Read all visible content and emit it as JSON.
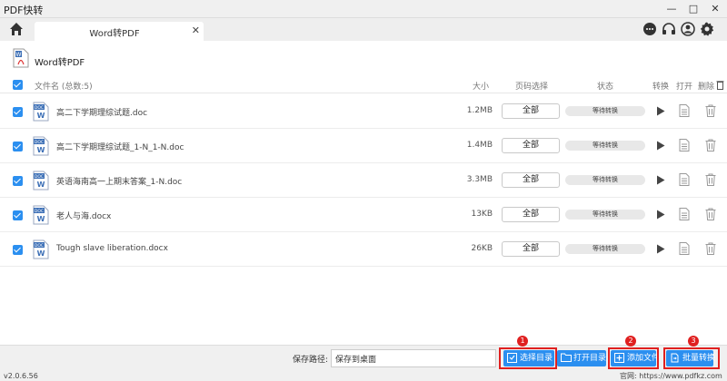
{
  "window": {
    "title": "PDF快转",
    "minimize": "—",
    "maximize": "□",
    "close": "✕"
  },
  "tab": {
    "label": "Word转PDF",
    "close": "✕"
  },
  "panel": {
    "title": "Word转PDF"
  },
  "table": {
    "headers": {
      "filename": "文件名 (总数:5)",
      "size": "大小",
      "page": "页码选择",
      "status": "状态",
      "convert": "转换",
      "open": "打开",
      "delete": "删除"
    },
    "rows": [
      {
        "name": "高二下学期理综试题.doc",
        "size": "1.2MB",
        "page": "全部",
        "status": "等待转换",
        "icon_tag": "DOC",
        "icon_letter": "W"
      },
      {
        "name": "高二下学期理综试题_1-N_1-N.doc",
        "size": "1.4MB",
        "page": "全部",
        "status": "等待转换",
        "icon_tag": "DOC",
        "icon_letter": "W"
      },
      {
        "name": "英语海南高一上期末答案_1-N.doc",
        "size": "3.3MB",
        "page": "全部",
        "status": "等待转换",
        "icon_tag": "DOC",
        "icon_letter": "W"
      },
      {
        "name": "老人与海.docx",
        "size": "13KB",
        "page": "全部",
        "status": "等待转换",
        "icon_tag": "DOC",
        "icon_letter": "W"
      },
      {
        "name": "Tough slave liberation.docx",
        "size": "26KB",
        "page": "全部",
        "status": "等待转换",
        "icon_tag": "DOC",
        "icon_letter": "W"
      }
    ]
  },
  "bottom": {
    "save_label": "保存路径:",
    "save_value": "保存到桌面",
    "select_dir": "选择目录",
    "open_dir": "打开目录",
    "add_file": "添加文件",
    "batch_convert": "批量转换",
    "badge1": "1",
    "badge2": "2",
    "badge3": "3"
  },
  "footer": {
    "version": "v2.0.6.56",
    "website": "官网: https://www.pdfkz.com"
  },
  "colors": {
    "accent": "#2b8ff0",
    "highlight": "#e02020",
    "doc_icon": "#3c6fb6"
  }
}
